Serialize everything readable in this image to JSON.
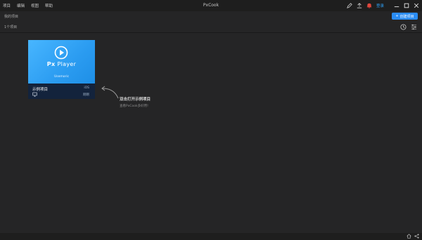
{
  "menu": [
    "项目",
    "编辑",
    "视图",
    "帮助"
  ],
  "app_title": "PxCook",
  "login": "登录",
  "breadcrumb": "我的项目",
  "new_project": {
    "icon": "+",
    "label": "创建项目"
  },
  "project_count": "1个项目",
  "card": {
    "brand_left": "Px",
    "brand_right": "Player",
    "author": "Usemoric",
    "name": "示例项目",
    "platform": "iOS",
    "time": "刚刚"
  },
  "hint": {
    "title": "双击打开示例项目",
    "subtitle": "查看PxCook多好用!"
  },
  "colors": {
    "accent": "#2a8cf5",
    "link": "#2e9ef2",
    "thumb": "#2b9cf1",
    "card_bottom": "#13233c",
    "background": "#252526"
  },
  "icons": [
    "pen-icon",
    "upload-icon",
    "bell-icon",
    "minimize-icon",
    "maximize-icon",
    "close-icon",
    "clock-icon",
    "filter-icon",
    "play-icon",
    "monitor-icon",
    "curved-arrow-icon",
    "home-icon",
    "share-icon"
  ]
}
